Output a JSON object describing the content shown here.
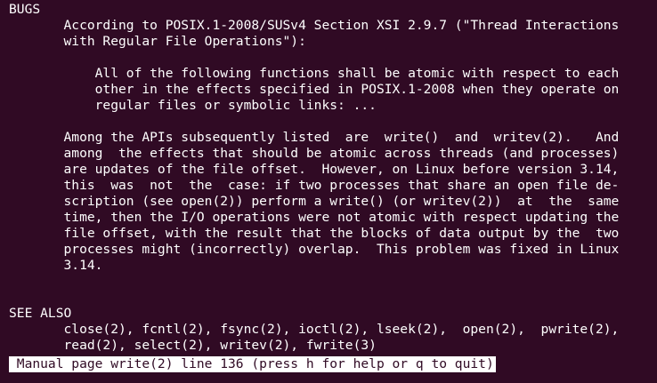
{
  "terminal": {
    "lines": [
      "BUGS",
      "       According to POSIX.1-2008/SUSv4 Section XSI 2.9.7 (\"Thread Interactions",
      "       with Regular File Operations\"):",
      "",
      "           All of the following functions shall be atomic with respect to each",
      "           other in the effects specified in POSIX.1-2008 when they operate on",
      "           regular files or symbolic links: ...",
      "",
      "       Among the APIs subsequently listed  are  write()  and  writev(2).   And",
      "       among  the effects that should be atomic across threads (and processes)",
      "       are updates of the file offset.  However, on Linux before version 3.14,",
      "       this  was  not  the  case: if two processes that share an open file de‐",
      "       scription (see open(2)) perform a write() (or writev(2))  at  the  same",
      "       time, then the I/O operations were not atomic with respect updating the",
      "       file offset, with the result that the blocks of data output by the  two",
      "       processes might (incorrectly) overlap.  This problem was fixed in Linux",
      "       3.14.",
      "",
      "SEE ALSO",
      "       close(2), fcntl(2), fsync(2), ioctl(2), lseek(2),  open(2),  pwrite(2),",
      "       read(2), select(2), writev(2), fwrite(3)"
    ],
    "status": " Manual page write(2) line 136 (press h for help or q to quit)"
  },
  "colors": {
    "background": "#300a24",
    "foreground": "#ffffff"
  }
}
